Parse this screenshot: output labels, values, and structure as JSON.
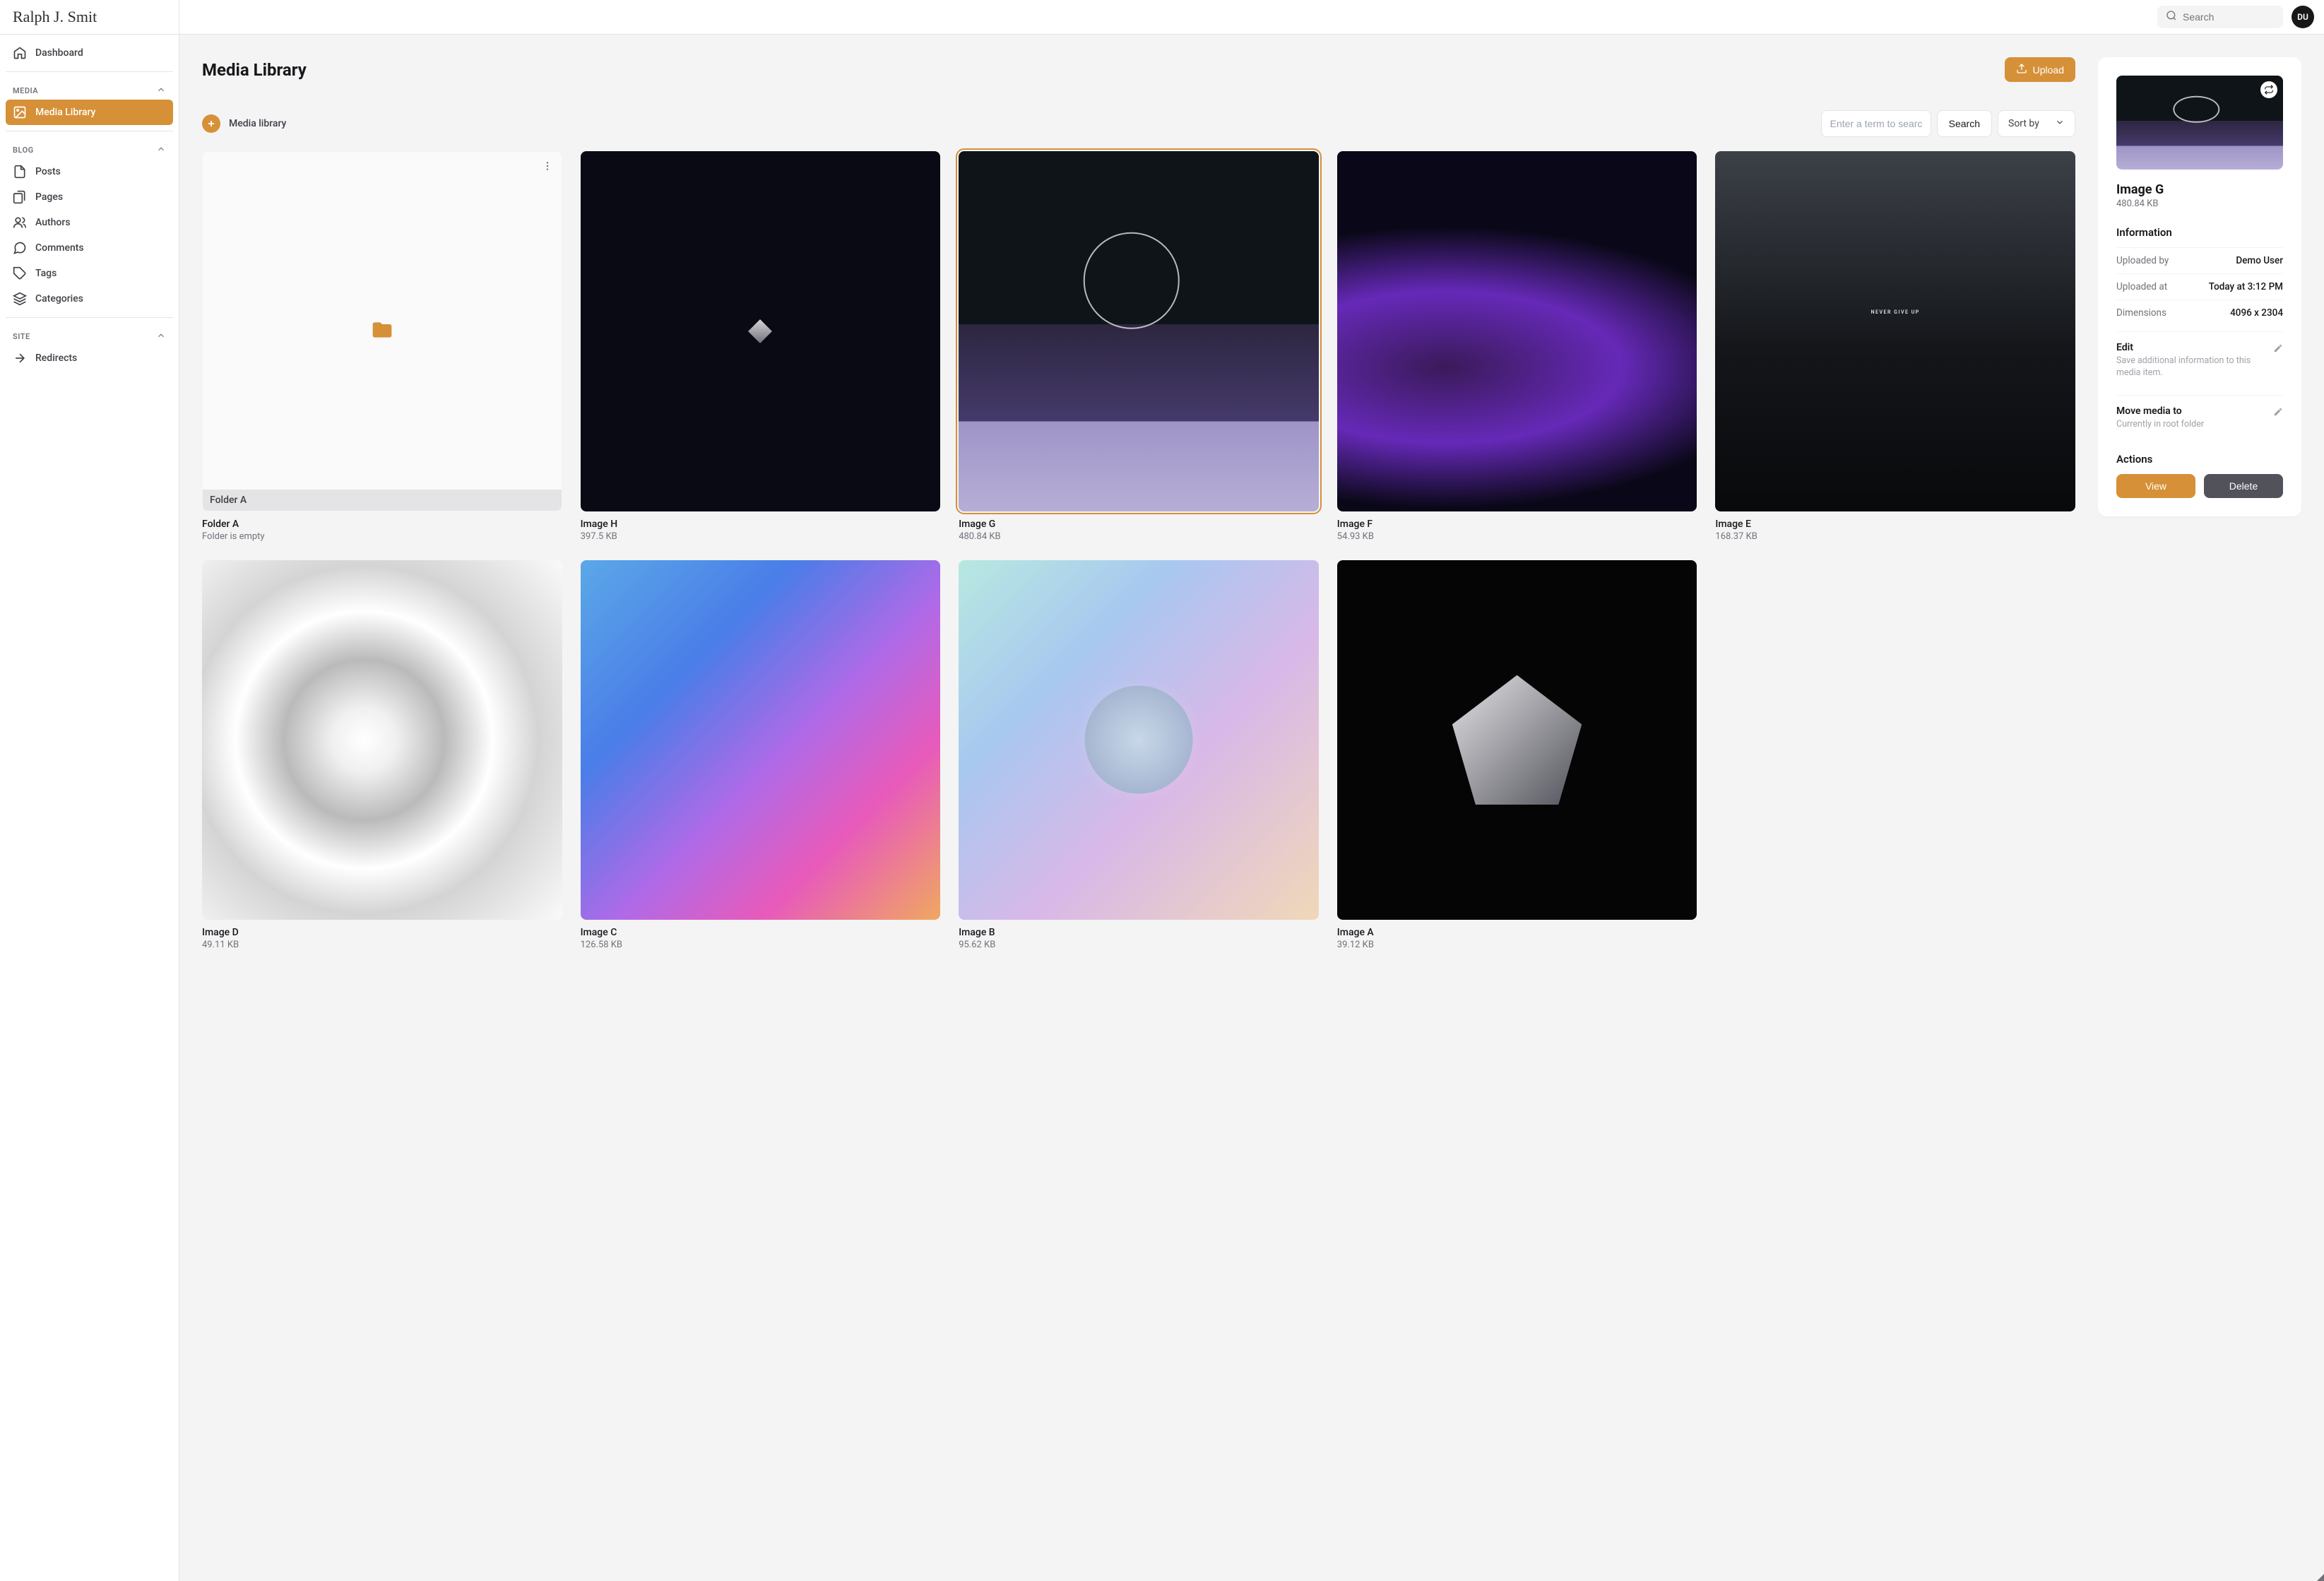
{
  "logo_text": "Ralph J. Smit",
  "sidebar": {
    "dashboard": "Dashboard",
    "sections": {
      "media": "MEDIA",
      "blog": "BLOG",
      "site": "SITE"
    },
    "items": {
      "media_library": "Media Library",
      "posts": "Posts",
      "pages": "Pages",
      "authors": "Authors",
      "comments": "Comments",
      "tags": "Tags",
      "categories": "Categories",
      "redirects": "Redirects"
    }
  },
  "topbar": {
    "search_placeholder": "Search",
    "avatar_initials": "DU"
  },
  "page": {
    "title": "Media Library",
    "upload_label": "Upload",
    "breadcrumb": "Media library",
    "search_placeholder": "Enter a term to search",
    "search_button": "Search",
    "sort_button": "Sort by"
  },
  "folder": {
    "badge": "Folder A",
    "name": "Folder A",
    "meta": "Folder is empty"
  },
  "items": {
    "h": {
      "name": "Image H",
      "size": "397.5 KB"
    },
    "g": {
      "name": "Image G",
      "size": "480.84 KB"
    },
    "f": {
      "name": "Image F",
      "size": "54.93 KB"
    },
    "e": {
      "name": "Image E",
      "size": "168.37 KB",
      "text": "NEVER GIVE UP"
    },
    "d": {
      "name": "Image D",
      "size": "49.11 KB"
    },
    "c": {
      "name": "Image C",
      "size": "126.58 KB"
    },
    "b": {
      "name": "Image B",
      "size": "95.62 KB"
    },
    "a": {
      "name": "Image A",
      "size": "39.12 KB"
    }
  },
  "detail": {
    "title": "Image G",
    "size": "480.84 KB",
    "info_heading": "Information",
    "uploaded_by_label": "Uploaded by",
    "uploaded_by": "Demo User",
    "uploaded_at_label": "Uploaded at",
    "uploaded_at": "Today at 3:12 PM",
    "dimensions_label": "Dimensions",
    "dimensions": "4096 x 2304",
    "edit_title": "Edit",
    "edit_desc": "Save additional information to this media item.",
    "move_title": "Move media to",
    "move_desc": "Currently in root folder",
    "actions_heading": "Actions",
    "view": "View",
    "delete": "Delete"
  }
}
